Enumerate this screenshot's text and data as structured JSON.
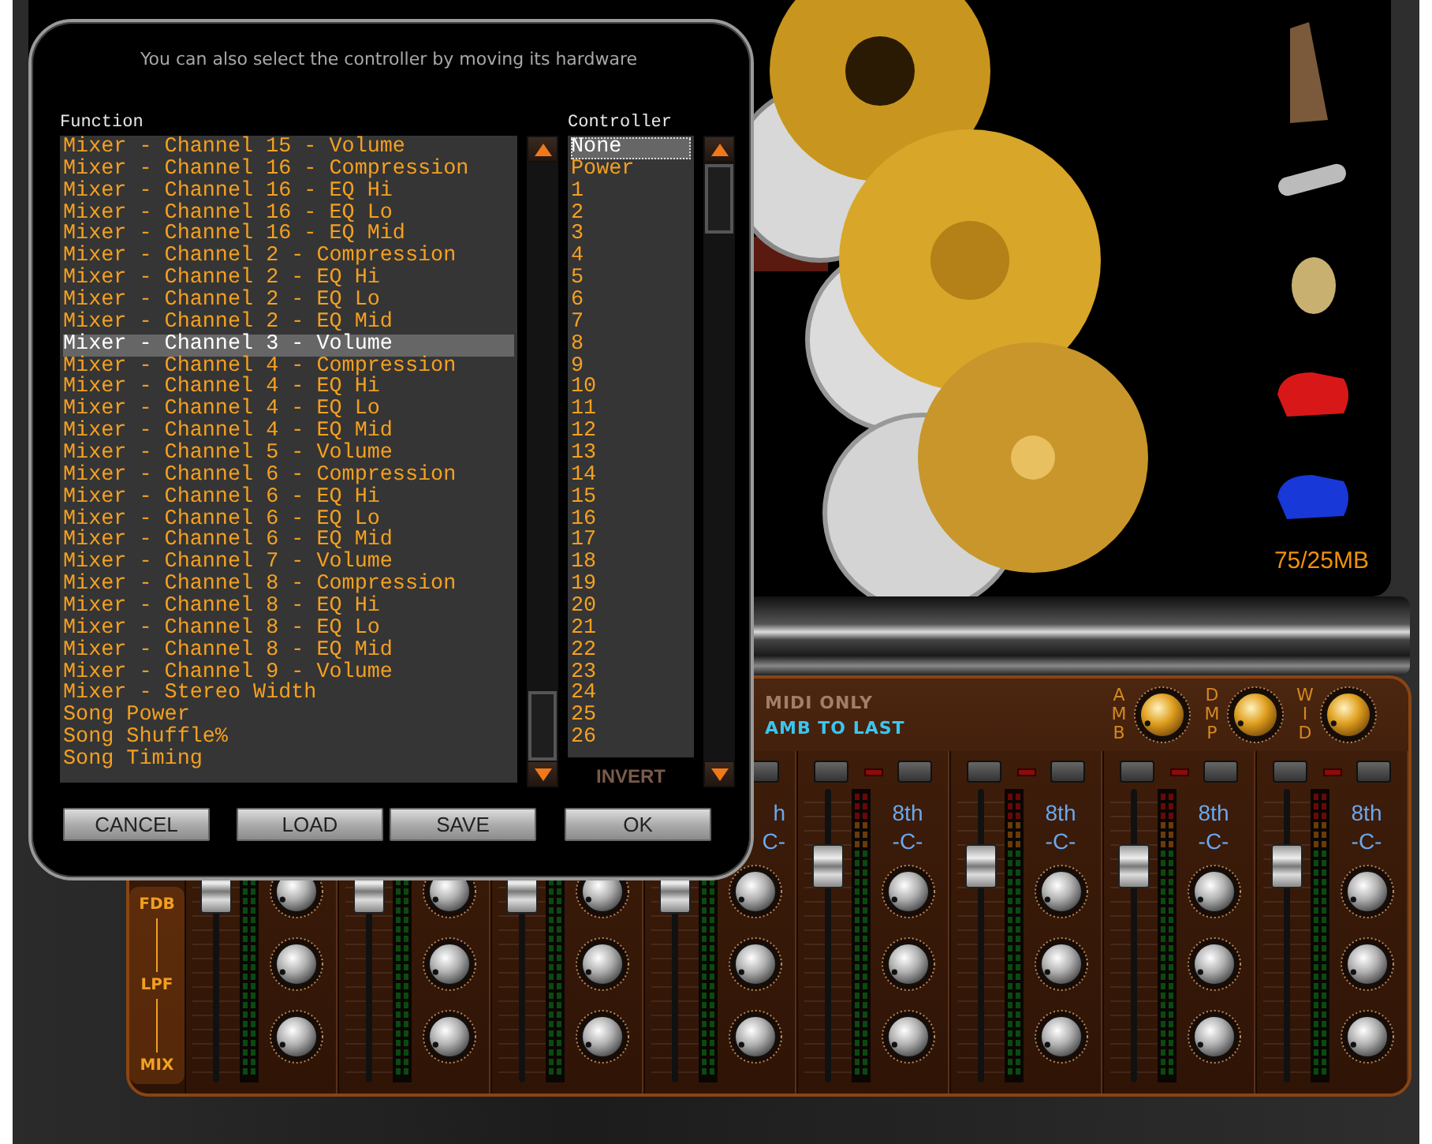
{
  "dialog": {
    "hint": "You can also select the controller by moving its hardware",
    "function_list": {
      "heading": "Function",
      "items": [
        {
          "label": "Mixer - Channel 15 - Volume",
          "selected": false
        },
        {
          "label": "Mixer - Channel 16 - Compression",
          "selected": false
        },
        {
          "label": "Mixer - Channel 16 - EQ Hi",
          "selected": false
        },
        {
          "label": "Mixer - Channel 16 - EQ Lo",
          "selected": false
        },
        {
          "label": "Mixer - Channel 16 - EQ Mid",
          "selected": false
        },
        {
          "label": "Mixer - Channel 2 - Compression",
          "selected": false
        },
        {
          "label": "Mixer - Channel 2 - EQ Hi",
          "selected": false
        },
        {
          "label": "Mixer - Channel 2 - EQ Lo",
          "selected": false
        },
        {
          "label": "Mixer - Channel 2 - EQ Mid",
          "selected": false
        },
        {
          "label": "Mixer - Channel 3 - Volume",
          "selected": true
        },
        {
          "label": "Mixer - Channel 4 - Compression",
          "selected": false
        },
        {
          "label": "Mixer - Channel 4 - EQ Hi",
          "selected": false
        },
        {
          "label": "Mixer - Channel 4 - EQ Lo",
          "selected": false
        },
        {
          "label": "Mixer - Channel 4 - EQ Mid",
          "selected": false
        },
        {
          "label": "Mixer - Channel 5 - Volume",
          "selected": false
        },
        {
          "label": "Mixer - Channel 6 - Compression",
          "selected": false
        },
        {
          "label": "Mixer - Channel 6 - EQ Hi",
          "selected": false
        },
        {
          "label": "Mixer - Channel 6 - EQ Lo",
          "selected": false
        },
        {
          "label": "Mixer - Channel 6 - EQ Mid",
          "selected": false
        },
        {
          "label": "Mixer - Channel 7 - Volume",
          "selected": false
        },
        {
          "label": "Mixer - Channel 8 - Compression",
          "selected": false
        },
        {
          "label": "Mixer - Channel 8 - EQ Hi",
          "selected": false
        },
        {
          "label": "Mixer - Channel 8 - EQ Lo",
          "selected": false
        },
        {
          "label": "Mixer - Channel 8 - EQ Mid",
          "selected": false
        },
        {
          "label": "Mixer - Channel 9 - Volume",
          "selected": false
        },
        {
          "label": "Mixer - Stereo Width",
          "selected": false
        },
        {
          "label": "Song Power",
          "selected": false
        },
        {
          "label": "Song Shuffle%",
          "selected": false
        },
        {
          "label": "Song Timing",
          "selected": false
        }
      ]
    },
    "controller_list": {
      "heading": "Controller",
      "items": [
        {
          "label": "None",
          "selected": true
        },
        {
          "label": "Power",
          "selected": false
        },
        {
          "label": "1",
          "selected": false
        },
        {
          "label": "2",
          "selected": false
        },
        {
          "label": "3",
          "selected": false
        },
        {
          "label": "4",
          "selected": false
        },
        {
          "label": "5",
          "selected": false
        },
        {
          "label": "6",
          "selected": false
        },
        {
          "label": "7",
          "selected": false
        },
        {
          "label": "8",
          "selected": false
        },
        {
          "label": "9",
          "selected": false
        },
        {
          "label": "10",
          "selected": false
        },
        {
          "label": "11",
          "selected": false
        },
        {
          "label": "12",
          "selected": false
        },
        {
          "label": "13",
          "selected": false
        },
        {
          "label": "14",
          "selected": false
        },
        {
          "label": "15",
          "selected": false
        },
        {
          "label": "16",
          "selected": false
        },
        {
          "label": "17",
          "selected": false
        },
        {
          "label": "18",
          "selected": false
        },
        {
          "label": "19",
          "selected": false
        },
        {
          "label": "20",
          "selected": false
        },
        {
          "label": "21",
          "selected": false
        },
        {
          "label": "22",
          "selected": false
        },
        {
          "label": "23",
          "selected": false
        },
        {
          "label": "24",
          "selected": false
        },
        {
          "label": "25",
          "selected": false
        },
        {
          "label": "26",
          "selected": false
        }
      ]
    },
    "invert": {
      "label": "INVERT",
      "checked": false
    },
    "buttons": [
      "CANCEL",
      "LOAD",
      "SAVE",
      "OK"
    ]
  },
  "memory": "75/25MB",
  "mixer": {
    "modes": [
      {
        "label": "MIDI ONLY",
        "on": false
      },
      {
        "label": "AMB TO LAST",
        "on": true
      }
    ],
    "master_knobs": [
      {
        "label": "AMB"
      },
      {
        "label": "DMP"
      },
      {
        "label": "WID"
      }
    ],
    "row_labels": [
      "FDB",
      "LPF",
      "MIX"
    ],
    "channels": [
      {
        "kind": "covered",
        "level": 0.68
      },
      {
        "kind": "covered",
        "level": 0.68
      },
      {
        "kind": "covered",
        "level": 0.68
      },
      {
        "kind": "partial",
        "division": "h",
        "key": "C-",
        "level": 0.68
      },
      {
        "kind": "full",
        "division": "8th",
        "key": "-C-",
        "level": 0.78
      },
      {
        "kind": "full",
        "division": "8th",
        "key": "-C-",
        "level": 0.78
      },
      {
        "kind": "full",
        "division": "8th",
        "key": "-C-",
        "level": 0.78
      },
      {
        "kind": "full",
        "division": "8th",
        "key": "-C-",
        "level": 0.78
      }
    ]
  }
}
